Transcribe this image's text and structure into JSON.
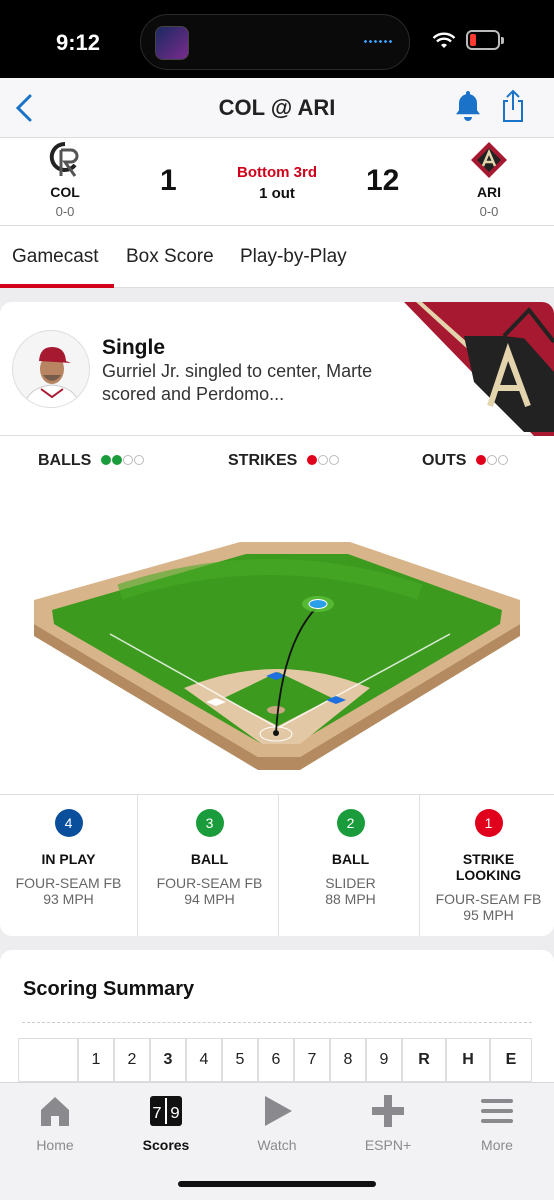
{
  "status_bar": {
    "time": "9:12"
  },
  "nav": {
    "title": "COL @ ARI"
  },
  "scoreboard": {
    "away": {
      "abbr": "COL",
      "record": "0-0",
      "score": "1"
    },
    "home": {
      "abbr": "ARI",
      "record": "0-0",
      "score": "12"
    },
    "inning": "Bottom 3rd",
    "outs_text": "1 out"
  },
  "tabs": [
    "Gamecast",
    "Box Score",
    "Play-by-Play"
  ],
  "play": {
    "headline": "Single",
    "description": "Gurriel Jr. singled to center, Marte scored and Perdomo..."
  },
  "count": {
    "balls_label": "BALLS",
    "balls": 2,
    "strikes_label": "STRIKES",
    "strikes": 1,
    "outs_label": "OUTS",
    "outs": 1
  },
  "pitches": [
    {
      "num": "4",
      "color": "#0a4f9c",
      "result": "IN PLAY",
      "type": "FOUR-SEAM FB",
      "speed": "93 MPH"
    },
    {
      "num": "3",
      "color": "#1a9c3c",
      "result": "BALL",
      "type": "FOUR-SEAM FB",
      "speed": "94 MPH"
    },
    {
      "num": "2",
      "color": "#1a9c3c",
      "result": "BALL",
      "type": "SLIDER",
      "speed": "88 MPH"
    },
    {
      "num": "1",
      "color": "#e0001b",
      "result": "STRIKE LOOKING",
      "type": "FOUR-SEAM FB",
      "speed": "95 MPH"
    }
  ],
  "scoring_summary": {
    "title": "Scoring Summary",
    "headers": [
      "",
      "1",
      "2",
      "3",
      "4",
      "5",
      "6",
      "7",
      "8",
      "9",
      "R",
      "H",
      "E"
    ]
  },
  "tabbar": [
    {
      "label": "Home",
      "icon": "home-icon"
    },
    {
      "label": "Scores",
      "icon": "scores-icon"
    },
    {
      "label": "Watch",
      "icon": "play-icon"
    },
    {
      "label": "ESPN+",
      "icon": "plus-icon"
    },
    {
      "label": "More",
      "icon": "menu-icon"
    }
  ]
}
